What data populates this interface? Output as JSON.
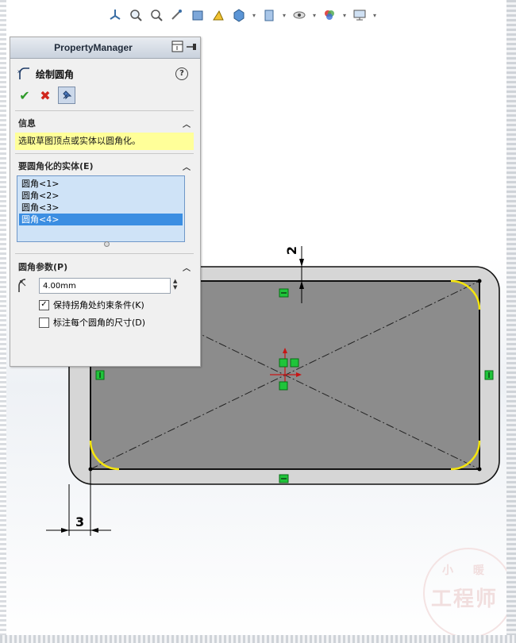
{
  "panel": {
    "title": "PropertyManager",
    "feature_title": "绘制圆角",
    "help_label": "?"
  },
  "info_group": {
    "heading": "信息",
    "message": "选取草图顶点或实体以圆角化。"
  },
  "entities_group": {
    "heading": "要圆角化的实体(E)",
    "items": [
      "圆角<1>",
      "圆角<2>",
      "圆角<3>",
      "圆角<4>"
    ],
    "selected_index": 3
  },
  "params_group": {
    "heading": "圆角参数(P)",
    "radius_value": "4.00mm",
    "keep_constraints_label": "保持拐角处约束条件(K)",
    "keep_constraints_checked": true,
    "dimension_each_label": "标注每个圆角的尺寸(D)",
    "dimension_each_checked": false
  },
  "sketch": {
    "dim_vertical": "2",
    "dim_horizontal": "3"
  },
  "watermark": {
    "top": "小 暖",
    "main": "工程师"
  },
  "colors": {
    "fill": "#8c8c8c",
    "body_gray": "#d4d4d4",
    "fillet_arc": "#f5e50c",
    "constraint_green": "#1fc43a",
    "selected_item": "#3b8ee2",
    "info_yellow": "#ffff99"
  }
}
